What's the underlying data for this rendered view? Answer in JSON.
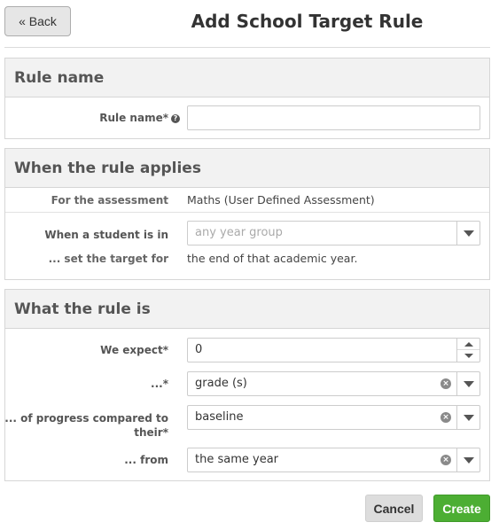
{
  "header": {
    "back_label": "« Back",
    "title": "Add School Target Rule"
  },
  "rule_name": {
    "heading": "Rule name",
    "label": "Rule name*",
    "help_icon": "question-circle-icon",
    "value": ""
  },
  "applies": {
    "heading": "When the rule applies",
    "assessment_label": "For the assessment",
    "assessment_value": "Maths (User Defined Assessment)",
    "student_label": "When a student is in",
    "student_placeholder": "any year group",
    "target_label": "... set the target for",
    "target_value": "the end of that academic year."
  },
  "rule": {
    "heading": "What the rule is",
    "expect_label": "We expect*",
    "expect_value": "0",
    "unit_label": "...*",
    "unit_value": "grade (s)",
    "progress_label_line1": "... of progress compared to",
    "progress_label_line2": "their*",
    "progress_value": "baseline",
    "from_label": "... from",
    "from_value": "the same year"
  },
  "actions": {
    "cancel_label": "Cancel",
    "create_label": "Create"
  },
  "colors": {
    "create_button": "#4cae33",
    "panel_heading_bg": "#f2f2f2"
  }
}
